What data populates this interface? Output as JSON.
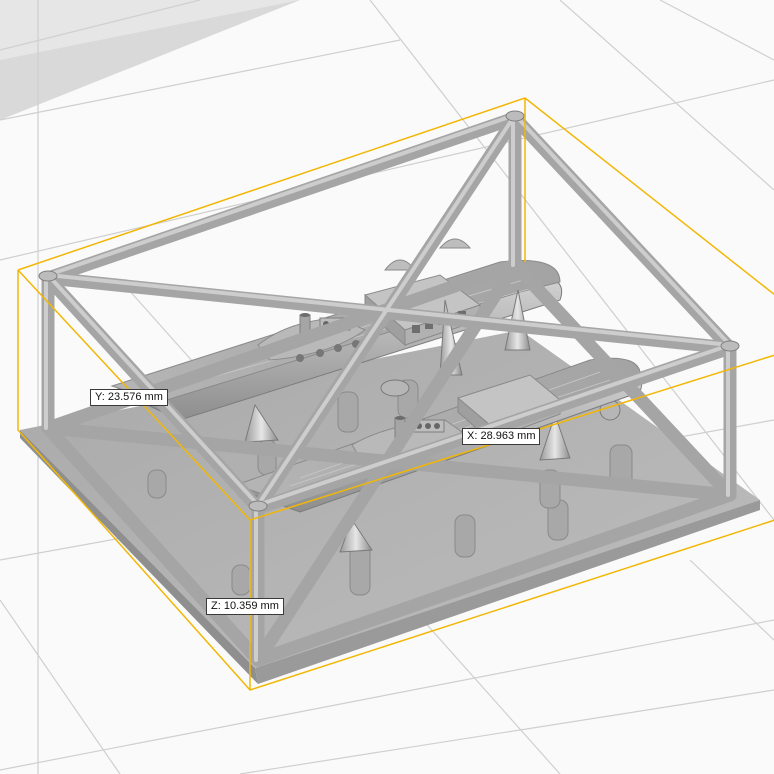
{
  "viewport": {
    "bounding_box_color": "#f2b705",
    "dimensions": {
      "x": "X: 28.963 mm",
      "y": "Y: 23.576 mm",
      "z": "Z: 10.359 mm"
    }
  }
}
